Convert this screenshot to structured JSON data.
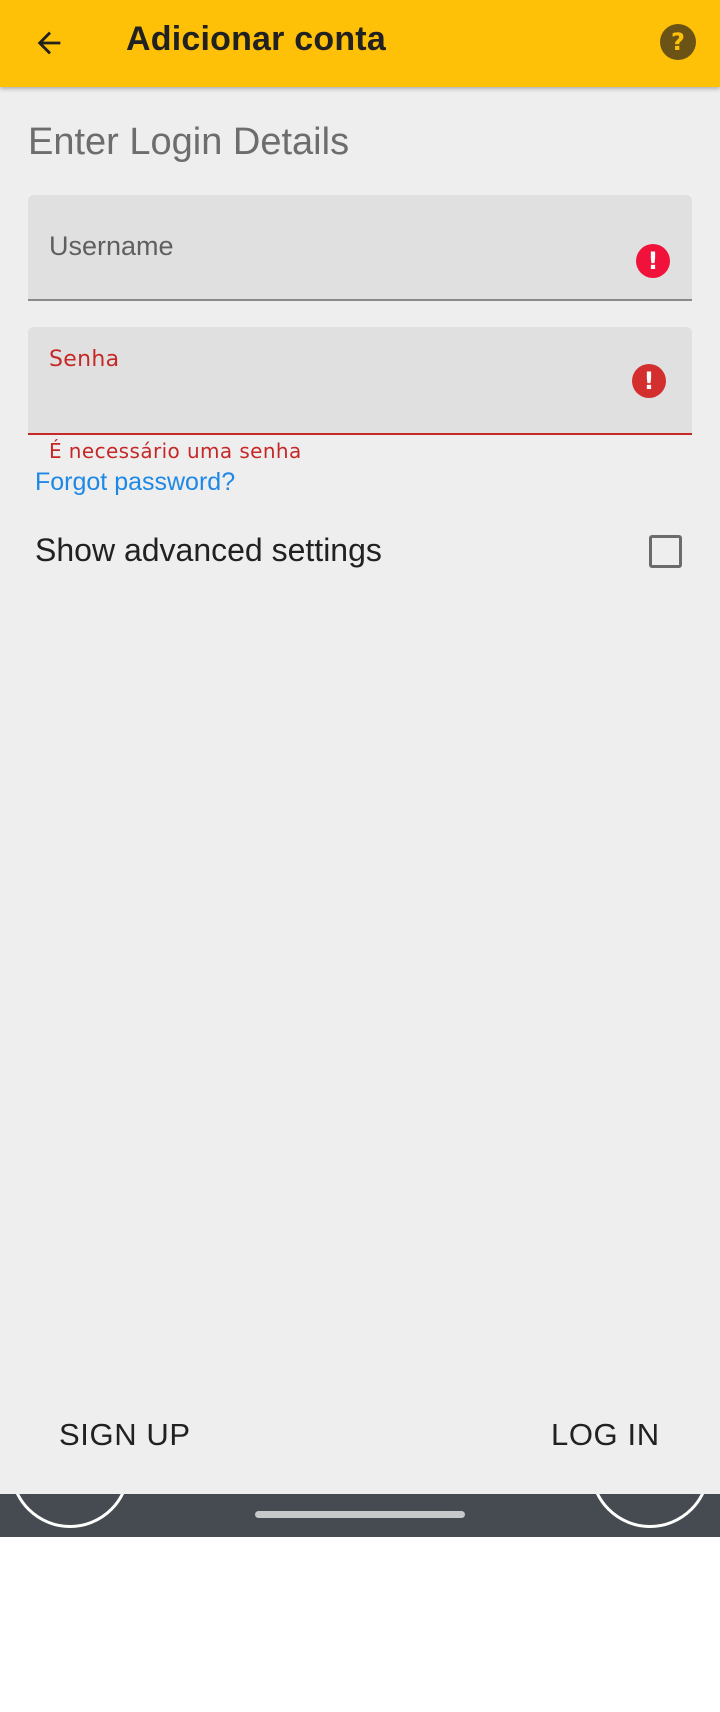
{
  "appbar": {
    "title": "Adicionar conta",
    "back_icon": "arrow-left-icon",
    "help_icon": "help-circle-icon",
    "help_glyph": "?",
    "color": "#ffc107"
  },
  "form": {
    "section_title": "Enter Login Details",
    "username": {
      "placeholder": "Username",
      "error_icon": "error-icon",
      "error_glyph": "!"
    },
    "password": {
      "label": "Senha",
      "error_text": "É necessário uma senha",
      "error_icon": "error-icon",
      "error_glyph": "!"
    },
    "forgot_password": "Forgot password?",
    "advanced_settings": {
      "label": "Show advanced settings",
      "checked": false
    }
  },
  "actions": {
    "signup": "SIGN UP",
    "login": "LOG IN"
  },
  "colors": {
    "error": "#c62828",
    "link": "#1e88e5",
    "background": "#eeeeee"
  }
}
